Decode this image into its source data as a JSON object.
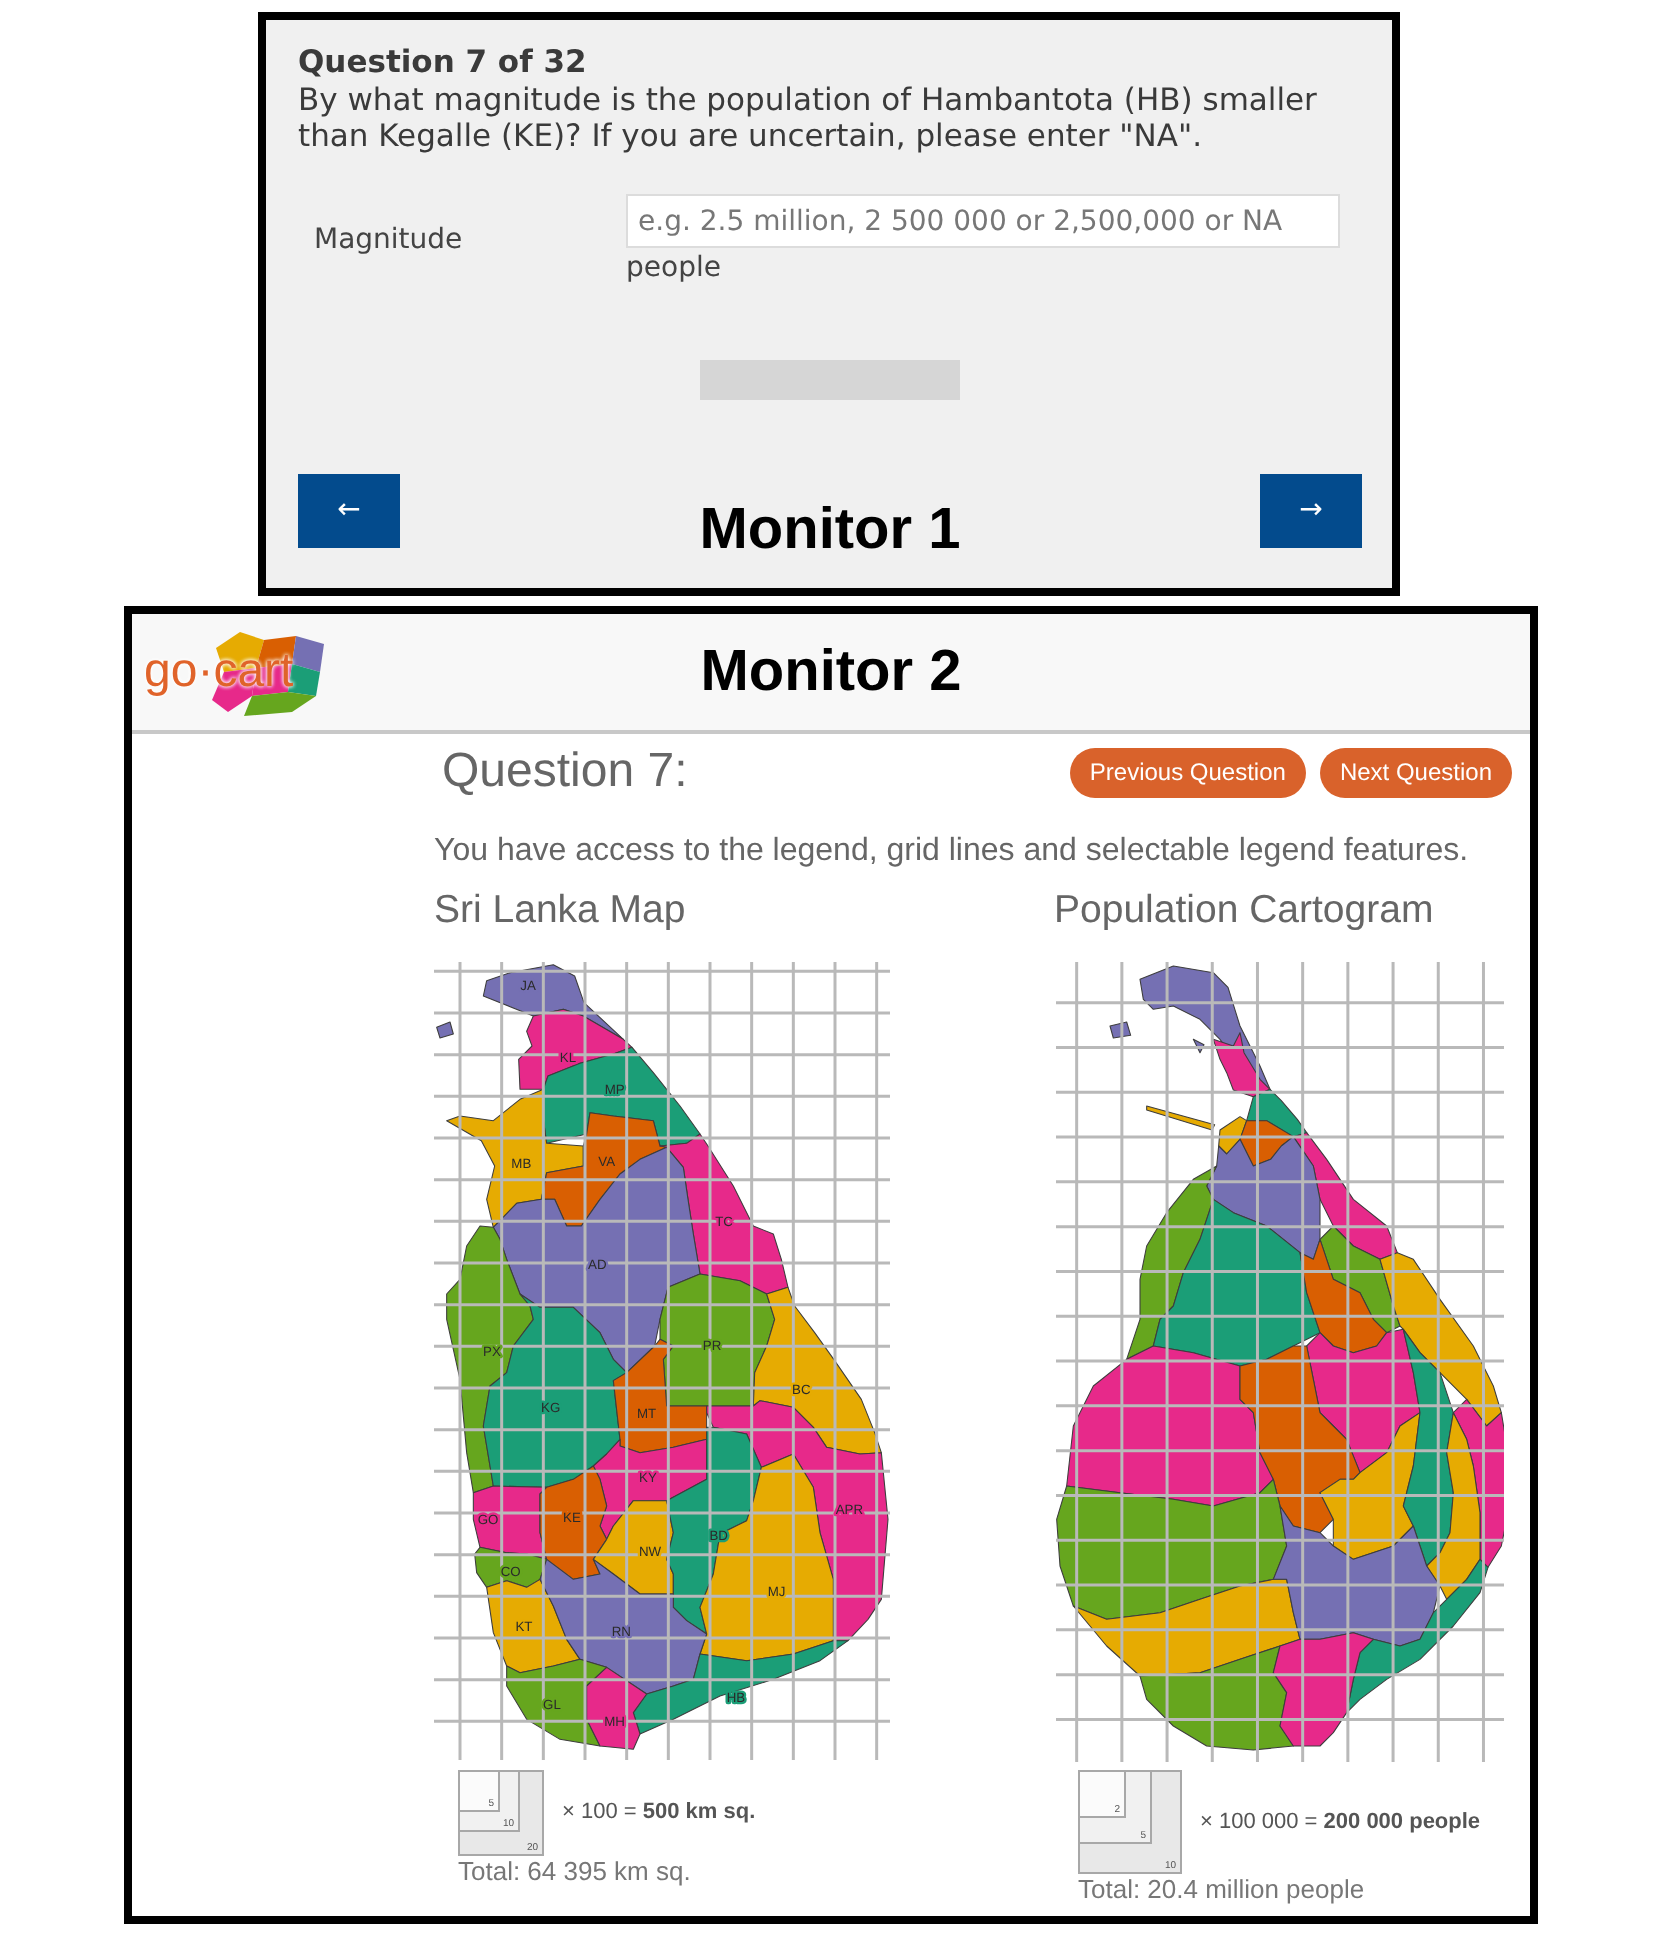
{
  "monitor_1": {
    "question_number": "Question 7 of 32",
    "question": "By what magnitude is the population of Hambantota (HB) smaller than Kegalle (KE)? If you are uncertain, please enter \"NA\".",
    "field": {
      "label": "Magnitude",
      "placeholder": "e.g. 2.5 million, 2 500 000 or 2,500,000 or NA",
      "unit": "people"
    },
    "back_button": "←",
    "forward_button": "→",
    "caption": "Monitor 1"
  },
  "monitor_2": {
    "logo": "go·cart",
    "caption": "Monitor 2",
    "title": "Question 7:",
    "buttons": [
      "Previous Question",
      "Next Question"
    ],
    "instructions": "You have access to the legend, grid lines and selectable legend features.",
    "map_title": "Sri Lanka Map",
    "cartogram_title": "Population Cartogram",
    "districts": [
      {
        "label": "JA",
        "color": "#7570b3"
      },
      {
        "label": "KL",
        "color": "#e7298a"
      },
      {
        "label": "MP",
        "color": "#1b9e77"
      },
      {
        "label": "MB",
        "color": "#e6ab02"
      },
      {
        "label": "VA",
        "color": "#d95f02"
      },
      {
        "label": "TC",
        "color": "#e7298a"
      },
      {
        "label": "AD",
        "color": "#7570b3"
      },
      {
        "label": "PX",
        "color": "#66a61e"
      },
      {
        "label": "PR",
        "color": "#66a61e"
      },
      {
        "label": "BC",
        "color": "#e6ab02"
      },
      {
        "label": "KG",
        "color": "#1b9e77"
      },
      {
        "label": "MT",
        "color": "#d95f02"
      },
      {
        "label": "KY",
        "color": "#e7298a"
      },
      {
        "label": "GO",
        "color": "#e7298a"
      },
      {
        "label": "KE",
        "color": "#d95f02"
      },
      {
        "label": "APR",
        "color": "#e7298a"
      },
      {
        "label": "CO",
        "color": "#66a61e"
      },
      {
        "label": "NW",
        "color": "#e6ab02"
      },
      {
        "label": "BD",
        "color": "#1b9e77"
      },
      {
        "label": "MJ",
        "color": "#e6ab02"
      },
      {
        "label": "KT",
        "color": "#e6ab02"
      },
      {
        "label": "RN",
        "color": "#7570b3"
      },
      {
        "label": "GL",
        "color": "#66a61e"
      },
      {
        "label": "HB",
        "color": "#1b9e77"
      },
      {
        "label": "MH",
        "color": "#e7298a"
      }
    ],
    "map_legend": {
      "squares": [
        "5",
        "10",
        "20"
      ],
      "formula": "× 100 = **500 km sq.**",
      "total": "Total: 64 395 km sq."
    },
    "cartogram_legend": {
      "squares": [
        "2",
        "5",
        "10"
      ],
      "formula": "× 100 000 = **200 000 people**",
      "total": "Total: 20.4 million people"
    }
  }
}
